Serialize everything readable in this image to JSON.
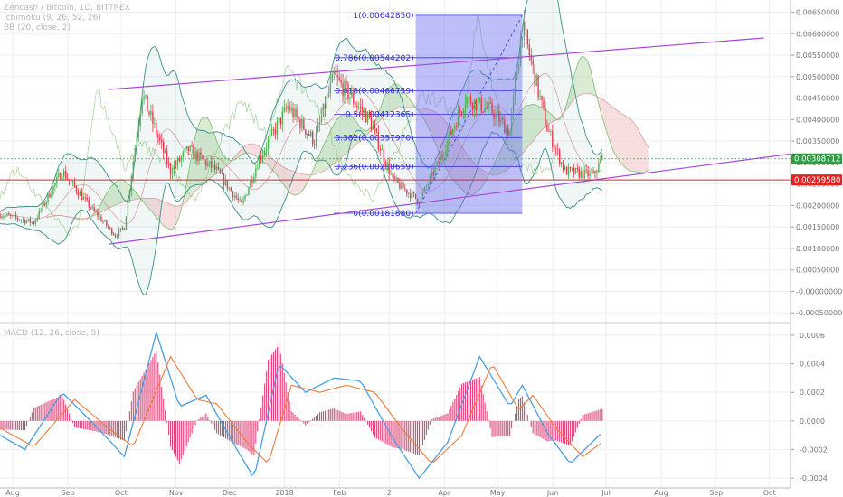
{
  "legend": {
    "pair": "Zencash / Bitcoin, 1D, BITTREX",
    "ichimoku": "Ichimoku (9, 26, 52, 26)",
    "bb": "BB (20, close, 2)",
    "macd": "MACD (12, 26, close, 9)"
  },
  "colors": {
    "up": "#4caf50",
    "down": "#e53950",
    "channel": "#a348d8",
    "fib": "#3535e8",
    "fib_fill": "#6f6ff0",
    "bb": "#3a8f86",
    "ichimoku_line": "#7fc06a",
    "ichimoku_red": "#e89aa0",
    "cloud_green": "#b9dcae",
    "cloud_red": "#f2c5c5",
    "macd_line": "#4a9fe0",
    "signal_line": "#f07b3c",
    "hist": "#e0457a",
    "price_tag_green": "#2e9e45",
    "price_tag_red": "#e02424"
  },
  "chart_data": [
    {
      "type": "candlestick",
      "title": "Zencash / Bitcoin, 1D, BITTREX",
      "x_axis": {
        "tick_labels": [
          "Aug",
          "Sep",
          "Oct",
          "Nov",
          "Dec",
          "2018",
          "Feb",
          "2",
          "Apr",
          "May",
          "Jun",
          "Jul",
          "Aug",
          "Sep",
          "Oct"
        ],
        "range": [
          "2017-08-01",
          "2018-10-20"
        ]
      },
      "y_axis": {
        "tick_labels": [
          "0.00650000",
          "0.00600000",
          "0.00550000",
          "0.00500000",
          "0.00450000",
          "0.00400000",
          "0.00350000",
          "0.00300000",
          "0.00250000",
          "0.00200000",
          "0.00150000",
          "0.00100000",
          "0.00050000",
          "-0.00000000",
          "-0.00050000"
        ],
        "range": [
          -0.0006,
          0.0067
        ]
      },
      "price_tags": [
        {
          "label": "0.00308712",
          "value": 0.00308712,
          "color": "green"
        },
        {
          "label": "0.00259580",
          "value": 0.0025958,
          "color": "red"
        }
      ],
      "fibonacci": {
        "levels": [
          {
            "ratio": "1",
            "price": "0.00642850",
            "value": 0.0064285
          },
          {
            "ratio": "0.786",
            "price": "0.00544202",
            "value": 0.00544202
          },
          {
            "ratio": "0.618",
            "price": "0.00466759",
            "value": 0.00466759
          },
          {
            "ratio": "0.5",
            "price": "0.00412365",
            "value": 0.00412365
          },
          {
            "ratio": "0.382",
            "price": "0.00357970",
            "value": 0.0035797
          },
          {
            "ratio": "0.236",
            "price": "0.00290659",
            "value": 0.00290659
          },
          {
            "ratio": "0",
            "price": "0.00181880",
            "value": 0.0018188
          }
        ],
        "label_text": [
          "1(0.00642850)",
          "0.786(0.00544202)",
          "0.618(0.00466759)",
          "0.5(0.00412365)",
          "0.382(0.00357970)",
          "0.236(0.00290659)",
          "0(0.00181880)"
        ]
      },
      "channel": {
        "upper": [
          {
            "date": "2017-10-01",
            "value": 0.0047
          },
          {
            "date": "2018-10-05",
            "value": 0.0059
          }
        ],
        "lower": [
          {
            "date": "2017-10-01",
            "value": 0.0011
          },
          {
            "date": "2018-10-20",
            "value": 0.0032
          }
        ]
      },
      "series": {
        "price_anchors": [
          {
            "date": "2017-08-01",
            "value": 0.0018
          },
          {
            "date": "2017-08-20",
            "value": 0.0016
          },
          {
            "date": "2017-09-05",
            "value": 0.0028
          },
          {
            "date": "2017-09-20",
            "value": 0.002
          },
          {
            "date": "2017-10-05",
            "value": 0.0013
          },
          {
            "date": "2017-10-10",
            "value": 0.0015
          },
          {
            "date": "2017-10-20",
            "value": 0.0046
          },
          {
            "date": "2017-11-05",
            "value": 0.0028
          },
          {
            "date": "2017-11-15",
            "value": 0.0033
          },
          {
            "date": "2017-12-01",
            "value": 0.0028
          },
          {
            "date": "2017-12-15",
            "value": 0.002
          },
          {
            "date": "2017-12-25",
            "value": 0.0031
          },
          {
            "date": "2018-01-10",
            "value": 0.0043
          },
          {
            "date": "2018-01-25",
            "value": 0.0035
          },
          {
            "date": "2018-02-05",
            "value": 0.005
          },
          {
            "date": "2018-02-25",
            "value": 0.004
          },
          {
            "date": "2018-03-10",
            "value": 0.0026
          },
          {
            "date": "2018-03-25",
            "value": 0.0021
          },
          {
            "date": "2018-04-05",
            "value": 0.003
          },
          {
            "date": "2018-04-20",
            "value": 0.0045
          },
          {
            "date": "2018-05-05",
            "value": 0.0042
          },
          {
            "date": "2018-05-15",
            "value": 0.0037
          },
          {
            "date": "2018-05-22",
            "value": 0.0062
          },
          {
            "date": "2018-06-05",
            "value": 0.0038
          },
          {
            "date": "2018-06-15",
            "value": 0.0028
          },
          {
            "date": "2018-07-01",
            "value": 0.0027
          },
          {
            "date": "2018-07-06",
            "value": 0.0031
          }
        ]
      }
    },
    {
      "type": "line",
      "title": "MACD (12, 26, close, 9)",
      "y_axis": {
        "tick_labels": [
          "0.0006",
          "0.0004",
          "0.0002",
          "0.0000",
          "-0.0002",
          "-0.0004"
        ],
        "range": [
          -0.00045,
          0.00065
        ]
      },
      "series": [
        {
          "name": "MACD",
          "points": [
            {
              "date": "2017-08-01",
              "value": -0.0001
            },
            {
              "date": "2017-08-15",
              "value": -0.0002
            },
            {
              "date": "2017-09-05",
              "value": 0.0002
            },
            {
              "date": "2017-09-25",
              "value": -5e-05
            },
            {
              "date": "2017-10-10",
              "value": -0.00025
            },
            {
              "date": "2017-10-28",
              "value": 0.00062
            },
            {
              "date": "2017-11-10",
              "value": 0.0001
            },
            {
              "date": "2017-11-25",
              "value": 0.00018
            },
            {
              "date": "2017-12-10",
              "value": -0.00015
            },
            {
              "date": "2017-12-22",
              "value": -0.0004
            },
            {
              "date": "2018-01-05",
              "value": 0.0004
            },
            {
              "date": "2018-01-20",
              "value": 0.0002
            },
            {
              "date": "2018-02-05",
              "value": 0.0003
            },
            {
              "date": "2018-02-20",
              "value": 0.00028
            },
            {
              "date": "2018-03-10",
              "value": -0.00012
            },
            {
              "date": "2018-03-25",
              "value": -0.0004
            },
            {
              "date": "2018-04-10",
              "value": -0.00015
            },
            {
              "date": "2018-04-28",
              "value": 0.00045
            },
            {
              "date": "2018-05-15",
              "value": 0.0001
            },
            {
              "date": "2018-05-22",
              "value": 0.00025
            },
            {
              "date": "2018-06-05",
              "value": -8e-05
            },
            {
              "date": "2018-06-18",
              "value": -0.0003
            },
            {
              "date": "2018-07-06",
              "value": -8e-05
            }
          ]
        },
        {
          "name": "Signal",
          "points": [
            {
              "date": "2017-08-01",
              "value": -5e-05
            },
            {
              "date": "2017-08-20",
              "value": -0.00018
            },
            {
              "date": "2017-09-12",
              "value": 0.00015
            },
            {
              "date": "2017-10-01",
              "value": -5e-05
            },
            {
              "date": "2017-10-15",
              "value": -0.00018
            },
            {
              "date": "2017-11-05",
              "value": 0.00045
            },
            {
              "date": "2017-11-20",
              "value": 0.00015
            },
            {
              "date": "2017-12-01",
              "value": 0.00012
            },
            {
              "date": "2017-12-18",
              "value": -0.00015
            },
            {
              "date": "2017-12-30",
              "value": -0.0003
            },
            {
              "date": "2018-01-12",
              "value": 0.00025
            },
            {
              "date": "2018-01-28",
              "value": 0.0002
            },
            {
              "date": "2018-02-12",
              "value": 0.00025
            },
            {
              "date": "2018-02-28",
              "value": 0.0002
            },
            {
              "date": "2018-03-15",
              "value": -5e-05
            },
            {
              "date": "2018-04-01",
              "value": -0.0003
            },
            {
              "date": "2018-04-18",
              "value": -0.0001
            },
            {
              "date": "2018-05-05",
              "value": 0.0004
            },
            {
              "date": "2018-05-20",
              "value": 8e-05
            },
            {
              "date": "2018-05-28",
              "value": 0.00018
            },
            {
              "date": "2018-06-10",
              "value": -5e-05
            },
            {
              "date": "2018-06-25",
              "value": -0.00025
            },
            {
              "date": "2018-07-06",
              "value": -0.00015
            }
          ]
        }
      ]
    }
  ]
}
